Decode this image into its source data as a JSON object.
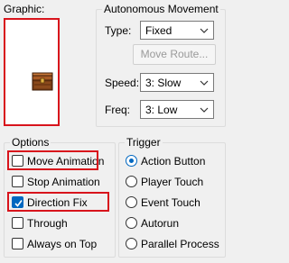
{
  "graphic": {
    "label": "Graphic:"
  },
  "autonomous_movement": {
    "title": "Autonomous Movement",
    "type_label": "Type:",
    "type_value": "Fixed",
    "move_route_label": "Move Route...",
    "speed_label": "Speed:",
    "speed_value": "3: Slow",
    "freq_label": "Freq:",
    "freq_value": "3: Low"
  },
  "options": {
    "title": "Options",
    "items": [
      {
        "label": "Move Animation",
        "checked": false
      },
      {
        "label": "Stop Animation",
        "checked": false
      },
      {
        "label": "Direction Fix",
        "checked": true
      },
      {
        "label": "Through",
        "checked": false
      },
      {
        "label": "Always on Top",
        "checked": false
      }
    ]
  },
  "trigger": {
    "title": "Trigger",
    "items": [
      {
        "label": "Action Button",
        "selected": true
      },
      {
        "label": "Player Touch",
        "selected": false
      },
      {
        "label": "Event Touch",
        "selected": false
      },
      {
        "label": "Autorun",
        "selected": false
      },
      {
        "label": "Parallel Process",
        "selected": false
      }
    ]
  },
  "colors": {
    "highlight": "#d8141c",
    "accent": "#0067c0",
    "chest": "#8b4a1c"
  }
}
